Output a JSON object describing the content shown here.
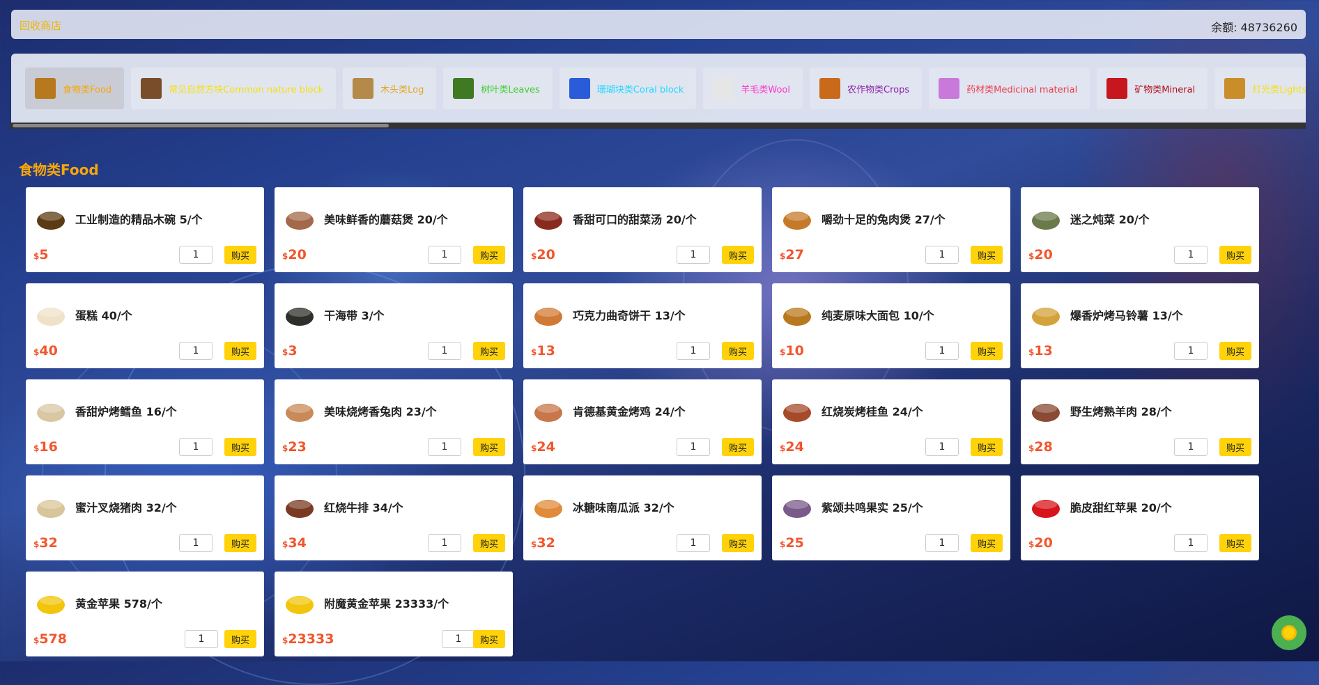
{
  "header": {
    "title": "回收商店",
    "balance": "余额: 48736260"
  },
  "categories": [
    {
      "label": "食物类Food",
      "color": "#f7a60b",
      "icon": "bread-icon",
      "icon_color": "#b8781e",
      "active": true
    },
    {
      "label": "常见自然方块Common nature block",
      "color": "#f5e10a",
      "icon": "dirt-block-icon",
      "icon_color": "#7a4d2a"
    },
    {
      "label": "木头类Log",
      "color": "#e3a81d",
      "icon": "log-icon",
      "icon_color": "#b4894a"
    },
    {
      "label": "树叶类Leaves",
      "color": "#3fcf2d",
      "icon": "leaves-icon",
      "icon_color": "#3f7a23"
    },
    {
      "label": "珊瑚块类Coral block",
      "color": "#22d7ff",
      "icon": "coral-block-icon",
      "icon_color": "#2a5bd8"
    },
    {
      "label": "羊毛类Wool",
      "color": "#ff33cc",
      "icon": "wool-icon",
      "icon_color": "#e6e6e6"
    },
    {
      "label": "农作物类Crops",
      "color": "#8a22a5",
      "icon": "crops-icon",
      "icon_color": "#c96a1a"
    },
    {
      "label": "药材类Medicinal material",
      "color": "#ea3d4a",
      "icon": "potion-icon",
      "icon_color": "#c979d9"
    },
    {
      "label": "矿物类Mineral",
      "color": "#b3101c",
      "icon": "mineral-icon",
      "icon_color": "#c6161e"
    },
    {
      "label": "灯光类Lights",
      "color": "#f5e10a",
      "icon": "light-icon",
      "icon_color": "#c98e2a"
    }
  ],
  "section_title": "食物类Food",
  "currency_symbol": "$",
  "buy_label": "购买",
  "default_qty": "1",
  "items": [
    {
      "name": "工业制造的精品木碗 5/个",
      "price": "5",
      "icon": "bowl-icon",
      "color": "#5b3b14"
    },
    {
      "name": "美味鲜香的蘑菇煲 20/个",
      "price": "20",
      "icon": "mushroom-stew-icon",
      "color": "#a4694a"
    },
    {
      "name": "香甜可口的甜菜汤 20/个",
      "price": "20",
      "icon": "beetroot-soup-icon",
      "color": "#8a2a1e"
    },
    {
      "name": "嚼劲十足的兔肉煲 27/个",
      "price": "27",
      "icon": "rabbit-stew-icon",
      "color": "#c57a2a"
    },
    {
      "name": "迷之炖菜 20/个",
      "price": "20",
      "icon": "suspicious-stew-icon",
      "color": "#6a7a4a"
    },
    {
      "name": "蛋糕 40/个",
      "price": "40",
      "icon": "cake-icon",
      "color": "#efe2c8"
    },
    {
      "name": "干海带 3/个",
      "price": "3",
      "icon": "dried-kelp-icon",
      "color": "#2e2e2a"
    },
    {
      "name": "巧克力曲奇饼干 13/个",
      "price": "13",
      "icon": "cookie-icon",
      "color": "#d17a35"
    },
    {
      "name": "纯麦原味大面包 10/个",
      "price": "10",
      "icon": "bread-icon",
      "color": "#b8781e"
    },
    {
      "name": "爆香炉烤马铃薯 13/个",
      "price": "13",
      "icon": "baked-potato-icon",
      "color": "#d4a23a"
    },
    {
      "name": "香甜炉烤鳕鱼 16/个",
      "price": "16",
      "icon": "cooked-cod-icon",
      "color": "#d9c7a4"
    },
    {
      "name": "美味烧烤香兔肉 23/个",
      "price": "23",
      "icon": "cooked-rabbit-icon",
      "color": "#c98a5a"
    },
    {
      "name": "肯德基黄金烤鸡 24/个",
      "price": "24",
      "icon": "cooked-chicken-icon",
      "color": "#c8764a"
    },
    {
      "name": "红烧炭烤桂鱼 24/个",
      "price": "24",
      "icon": "cooked-salmon-icon",
      "color": "#a64a2a"
    },
    {
      "name": "野生烤熟羊肉 28/个",
      "price": "28",
      "icon": "cooked-mutton-icon",
      "color": "#8a4a33"
    },
    {
      "name": "蜜汁叉烧猪肉 32/个",
      "price": "32",
      "icon": "cooked-porkchop-icon",
      "color": "#d9c59a"
    },
    {
      "name": "红烧牛排 34/个",
      "price": "34",
      "icon": "steak-icon",
      "color": "#7a3a22"
    },
    {
      "name": "冰糖味南瓜派 32/个",
      "price": "32",
      "icon": "pumpkin-pie-icon",
      "color": "#e08a3a"
    },
    {
      "name": "紫颂共鸣果实 25/个",
      "price": "25",
      "icon": "chorus-fruit-icon",
      "color": "#7a5a8a"
    },
    {
      "name": "脆皮甜红苹果 20/个",
      "price": "20",
      "icon": "apple-icon",
      "color": "#d8141a"
    },
    {
      "name": "黄金苹果 578/个",
      "price": "578",
      "icon": "golden-apple-icon",
      "color": "#f2c40a"
    },
    {
      "name": "附魔黄金苹果 23333/个",
      "price": "23333",
      "icon": "enchanted-golden-apple-icon",
      "color": "#f2c40a"
    }
  ]
}
